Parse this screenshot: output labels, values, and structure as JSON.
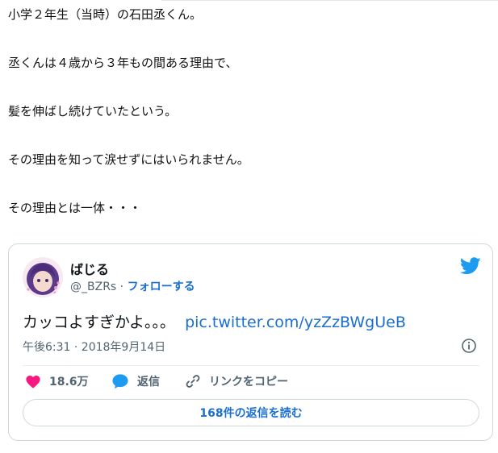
{
  "article": {
    "paragraphs": [
      "小学２年生（当時）の石田丞くん。",
      "丞くんは４歳から３年もの間ある理由で、",
      "髪を伸ばし続けていたという。",
      "その理由を知って涙せずにはいられません。",
      "その理由とは一体・・・"
    ]
  },
  "tweet": {
    "display_name": "ばじる",
    "handle": "@_BZRs",
    "separator": "·",
    "follow_label": "フォローする",
    "text": "カッコよすぎかよ。。。",
    "link": "pic.twitter.com/yzZzBWgUeB",
    "timestamp": "午後6:31 · 2018年9月14日",
    "likes_count": "18.6万",
    "reply_label": "返信",
    "copy_link_label": "リンクをコピー",
    "read_replies_label": "168件の返信を読む"
  },
  "colors": {
    "like": "#f91880",
    "reply": "#1d9bf0",
    "link": "#1b6fcf",
    "twitter_blue": "#1d9bf0"
  },
  "icons": {
    "bird": "twitter-bird-icon",
    "info": "info-icon",
    "heart": "heart-icon",
    "reply": "reply-bubble-icon",
    "link": "link-icon"
  }
}
